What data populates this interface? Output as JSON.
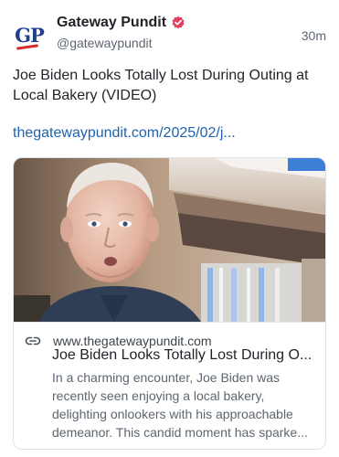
{
  "author": {
    "avatar_text": "GP",
    "display_name": "Gateway Pundit",
    "handle": "@gatewaypundit",
    "verified_icon": "verified-badge-icon"
  },
  "post": {
    "timestamp": "30m",
    "text": "Joe Biden Looks Totally Lost During Outing at Local Bakery (VIDEO)",
    "link": "thegatewaypundit.com/2025/02/j..."
  },
  "link_card": {
    "domain": "www.thegatewaypundit.com",
    "title": "Joe Biden Looks Totally Lost During O...",
    "description": "In a charming encounter, Joe Biden was recently seen enjoying a local bakery, delighting onlookers with his approachable demeanor. This candid moment has sparke...",
    "link_icon": "link-icon"
  },
  "colors": {
    "brand_blue": "#1d3f8e",
    "brand_red": "#d62b2b",
    "link": "#1f62b0",
    "verified": "#e0405e"
  }
}
